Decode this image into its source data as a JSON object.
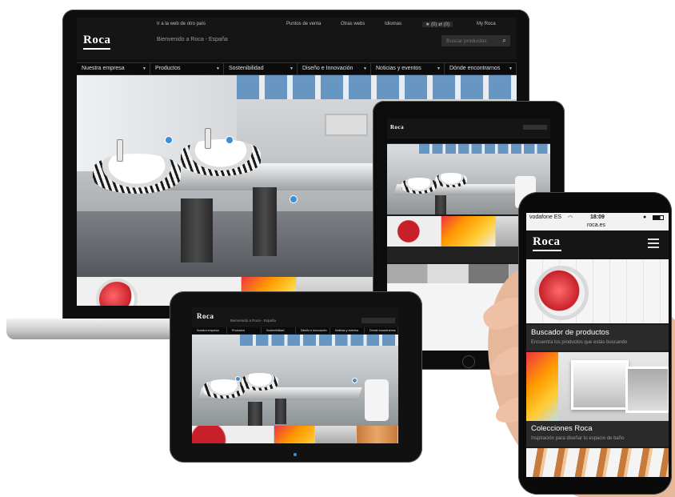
{
  "brand": {
    "logo": "Roca"
  },
  "laptop": {
    "top_links": [
      "Ir a la web de otro país",
      "Puntos de venta",
      "Otras webs",
      "Idiomas",
      "(0)",
      "(0)",
      "My Roca"
    ],
    "welcome": "Bienvenido a Roca - España",
    "search_placeholder": "Buscar productos",
    "nav": [
      "Nuestra empresa",
      "Productos",
      "Sostenibilidad",
      "Diseño e Innovación",
      "Noticias y eventos",
      "Dónde encontrarnos"
    ]
  },
  "small_tablet": {
    "welcome": "Bienvenido a Roca - España",
    "nav": [
      "Nuestra empresa",
      "Productos",
      "Sostenibilidad",
      "Diseño e Innovación",
      "Noticias y eventos",
      "Dónde encontrarnos"
    ]
  },
  "phone": {
    "carrier": "vodafone ES",
    "time": "18:09",
    "url": "roca.es",
    "card1_title": "Buscador de productos",
    "card1_sub": "Encuentra los productos que estás buscando",
    "card2_title": "Colecciones Roca",
    "card2_sub": "Inspiración para diseñar tu espacio de baño"
  },
  "colors": {
    "accent_blue": "#3c8fd6",
    "header_dark": "#151515",
    "red_accent": "#c8202a"
  }
}
